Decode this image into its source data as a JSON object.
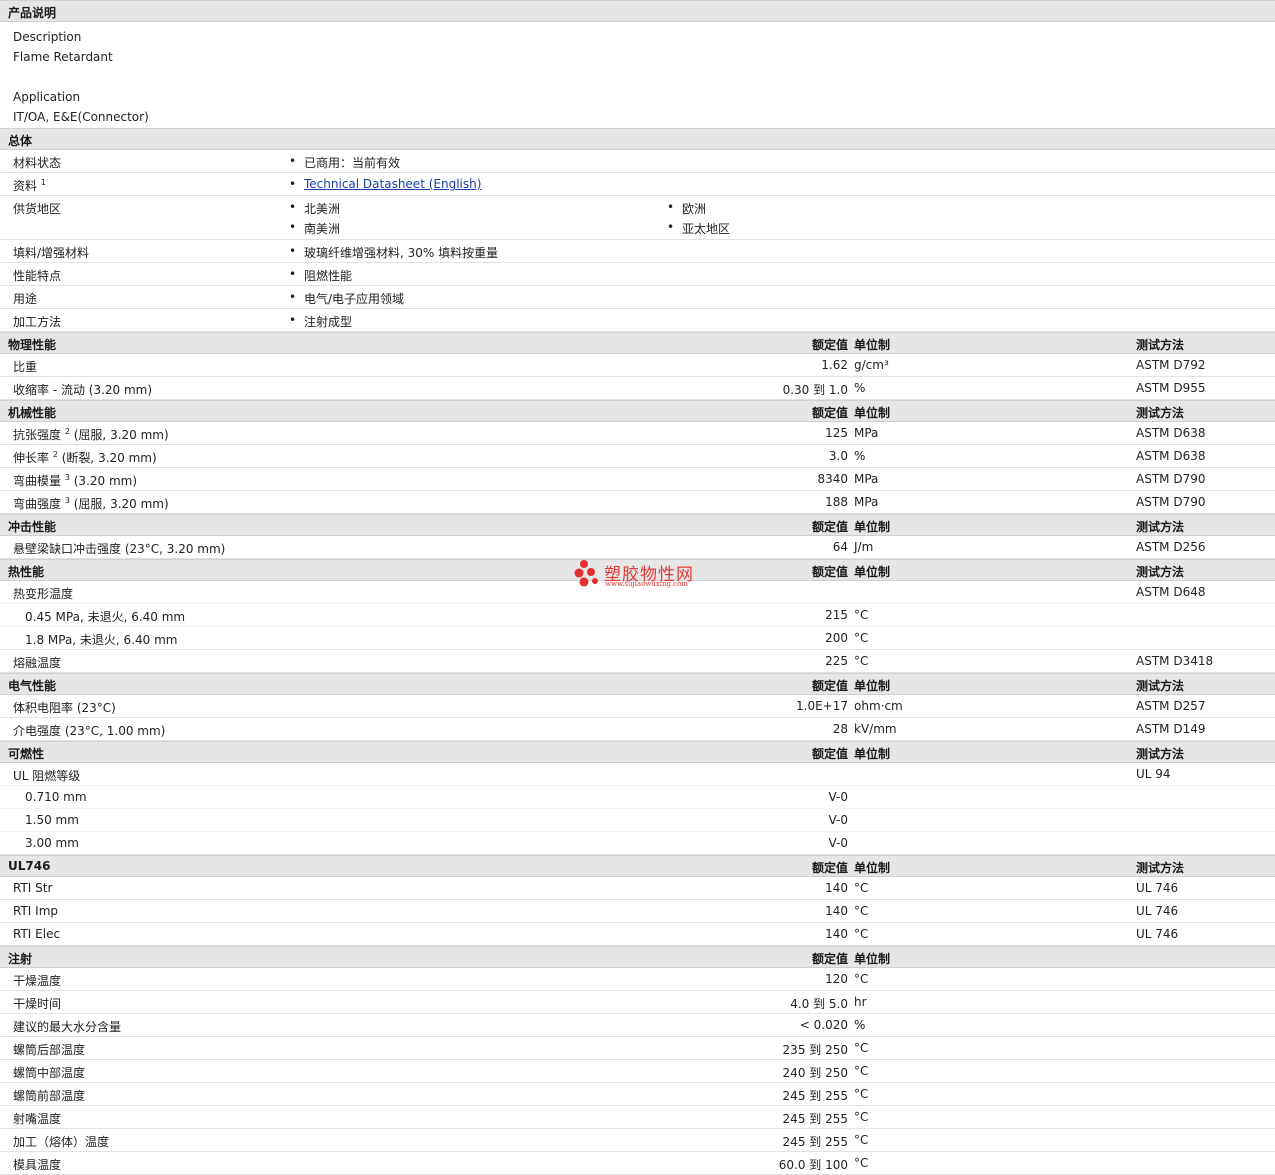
{
  "sections": {
    "desc": "产品说明",
    "general": "总体",
    "physical": "物理性能",
    "mechanical": "机械性能",
    "impact": "冲击性能",
    "thermal": "热性能",
    "electrical": "电气性能",
    "flammability": "可燃性",
    "ul746": "UL746",
    "injection": "注射"
  },
  "cols": {
    "value": "额定值",
    "unit": "单位制",
    "test": "测试方法"
  },
  "description": {
    "lines": [
      "Description",
      "Flame Retardant",
      "",
      "Application",
      "IT/OA, E&E(Connector)"
    ]
  },
  "general": {
    "status_label": "材料状态",
    "status": "已商用：当前有效",
    "doc_label": "资料",
    "doc_sup": "1",
    "doc_link": "Technical Datasheet (English)",
    "region_label": "供货地区",
    "regions": [
      "北美洲",
      "欧洲",
      "南美洲",
      "亚太地区"
    ],
    "filler_label": "填料/增强材料",
    "filler": "玻璃纤维增强材料, 30% 填料按重量",
    "feature_label": "性能特点",
    "feature": "阻燃性能",
    "use_label": "用途",
    "use": "电气/电子应用领域",
    "process_label": "加工方法",
    "process": "注射成型"
  },
  "physical": [
    {
      "label": "比重",
      "value": "1.62",
      "unit": "g/cm³",
      "test": "ASTM D792"
    },
    {
      "label": "收缩率  - 流动  (3.20 mm)",
      "value": "0.30 到  1.0",
      "unit": "%",
      "test": "ASTM D955"
    }
  ],
  "mechanical": [
    {
      "label": "抗张强度",
      "sup": "2",
      "cond": " (屈服, 3.20 mm)",
      "value": "125",
      "unit": "MPa",
      "test": "ASTM D638"
    },
    {
      "label": "伸长率",
      "sup": "2",
      "cond": " (断裂, 3.20 mm)",
      "value": "3.0",
      "unit": "%",
      "test": "ASTM D638"
    },
    {
      "label": "弯曲模量",
      "sup": "3",
      "cond": " (3.20 mm)",
      "value": "8340",
      "unit": "MPa",
      "test": "ASTM D790"
    },
    {
      "label": "弯曲强度",
      "sup": "3",
      "cond": " (屈服, 3.20 mm)",
      "value": "188",
      "unit": "MPa",
      "test": "ASTM D790"
    }
  ],
  "impact": [
    {
      "label": "悬壁梁缺口冲击强度  (23°C, 3.20 mm)",
      "value": "64",
      "unit": "J/m",
      "test": "ASTM D256"
    }
  ],
  "thermal": {
    "hdt_label": "热变形温度",
    "hdt_test": "ASTM D648",
    "hdt_rows": [
      {
        "label": "0.45 MPa, 未退火, 6.40 mm",
        "value": "215",
        "unit": "°C"
      },
      {
        "label": "1.8 MPa, 未退火, 6.40 mm",
        "value": "200",
        "unit": "°C"
      }
    ],
    "melt": {
      "label": "熔融温度",
      "value": "225",
      "unit": "°C",
      "test": "ASTM D3418"
    }
  },
  "electrical": [
    {
      "label": "体积电阻率  (23°C)",
      "value": "1.0E+17",
      "unit": "ohm·cm",
      "test": "ASTM D257"
    },
    {
      "label": "介电强度  (23°C, 1.00 mm)",
      "value": "28",
      "unit": "kV/mm",
      "test": "ASTM D149"
    }
  ],
  "flammability": {
    "label": "UL 阻燃等级",
    "test": "UL 94",
    "rows": [
      {
        "label": "0.710 mm",
        "value": "V-0"
      },
      {
        "label": "1.50 mm",
        "value": "V-0"
      },
      {
        "label": "3.00 mm",
        "value": "V-0"
      }
    ]
  },
  "ul746": [
    {
      "label": "RTI Str",
      "value": "140",
      "unit": "°C",
      "test": "UL 746"
    },
    {
      "label": "RTI Imp",
      "value": "140",
      "unit": "°C",
      "test": "UL 746"
    },
    {
      "label": "RTI Elec",
      "value": "140",
      "unit": "°C",
      "test": "UL 746"
    }
  ],
  "injection": [
    {
      "label": "干燥温度",
      "value": "120",
      "unit": "°C"
    },
    {
      "label": "干燥时间",
      "value": "4.0 到  5.0",
      "unit": "hr"
    },
    {
      "label": "建议的最大水分含量",
      "value": "< 0.020",
      "unit": "%"
    },
    {
      "label": "螺筒后部温度",
      "value": "235 到  250",
      "unit": "°C"
    },
    {
      "label": "螺筒中部温度",
      "value": "240 到  250",
      "unit": "°C"
    },
    {
      "label": "螺筒前部温度",
      "value": "245 到  255",
      "unit": "°C"
    },
    {
      "label": "射嘴温度",
      "value": "245 到  255",
      "unit": "°C"
    },
    {
      "label": "加工（熔体）温度",
      "value": "245 到  255",
      "unit": "°C"
    },
    {
      "label": "模具温度",
      "value": "60.0 到  100",
      "unit": "°C"
    }
  ],
  "watermark": {
    "cn": "塑胶物性网",
    "url": "www.sujiaowuxing.com"
  }
}
